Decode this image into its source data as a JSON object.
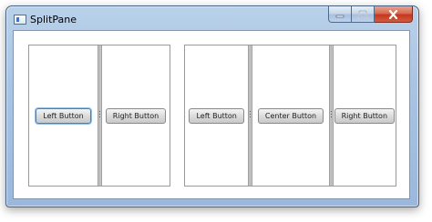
{
  "window": {
    "title": "SplitPane",
    "controls": {
      "minimize_icon": "minimize-icon",
      "maximize_icon": "maximize-icon",
      "close_icon": "close-icon"
    }
  },
  "split_pane_1": {
    "buttons": [
      {
        "label": "Left Button",
        "focused": true
      },
      {
        "label": "Right Button",
        "focused": false
      }
    ]
  },
  "split_pane_2": {
    "buttons": [
      {
        "label": "Left Button",
        "focused": false
      },
      {
        "label": "Center Button",
        "focused": false
      },
      {
        "label": "Right Button",
        "focused": false
      }
    ]
  },
  "colors": {
    "titlebar": "#a9c4e3",
    "close_button": "#c4381f",
    "focus_ring": "#3d83c6"
  }
}
